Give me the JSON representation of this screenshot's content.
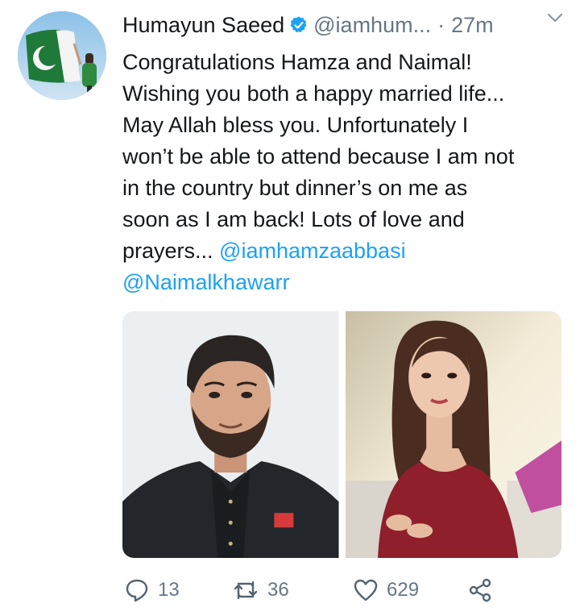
{
  "tweet": {
    "author_name": "Humayun Saeed",
    "handle": "@iamhum...",
    "separator": "·",
    "time": "27m",
    "text_lines": [
      "Congratulations Hamza and Naimal!",
      "Wishing you both a happy married life...",
      "May Allah bless you. Unfortunately I",
      "won’t be able to attend because I am not",
      "in the country but dinner’s on me as",
      "soon as I am back! Lots of love and"
    ],
    "last_line_prefix": "prayers... ",
    "mention_1": "@iamhamzaabbasi",
    "mention_2": "@Naimalkhawarr"
  },
  "actions": {
    "replies": "13",
    "retweets": "36",
    "likes": "629"
  },
  "icons": {
    "verified": "verified-badge-icon",
    "caret": "chevron-down-icon",
    "reply": "reply-icon",
    "retweet": "retweet-icon",
    "like": "heart-icon",
    "share": "share-icon"
  },
  "colors": {
    "text": "#14171a",
    "muted": "#657786",
    "link": "#1da1f2"
  }
}
